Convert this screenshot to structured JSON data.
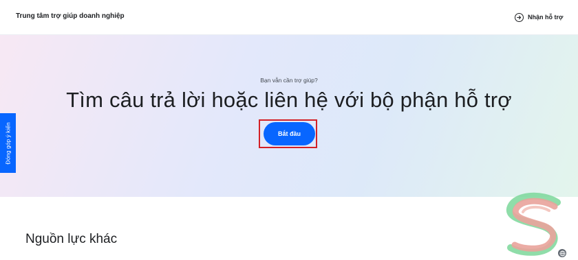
{
  "header": {
    "title": "Trung tâm trợ giúp doanh nghiệp",
    "get_help_label": "Nhận hỗ trợ"
  },
  "hero": {
    "subtitle": "Bạn vẫn cần trợ giúp?",
    "title": "Tìm câu trả lời hoặc liên hệ với bộ phận hỗ trợ",
    "cta_label": "Bắt đầu"
  },
  "feedback": {
    "label": "Đóng góp ý kiến"
  },
  "resources": {
    "title": "Nguồn lực khác"
  },
  "colors": {
    "accent": "#0866ff",
    "highlight_border": "#d32026",
    "text": "#1c1e21"
  },
  "icons": {
    "get_help": "arrow-right-circle-icon",
    "language": "globe-icon"
  }
}
